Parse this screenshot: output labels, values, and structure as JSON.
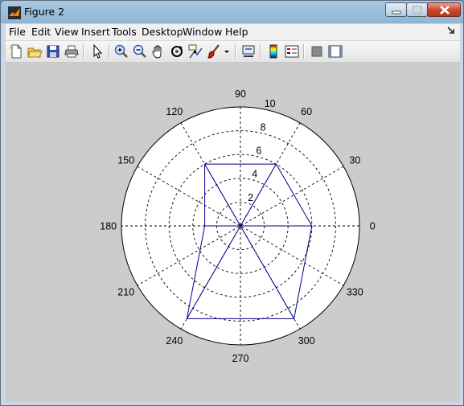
{
  "window": {
    "title": "Figure 2",
    "icon": "matlab-logo-icon"
  },
  "menubar": {
    "items": [
      "File",
      "Edit",
      "View",
      "Insert",
      "Tools",
      "Desktop",
      "Window",
      "Help"
    ],
    "dock_icon": "dock-arrow-icon"
  },
  "toolbar": {
    "buttons": [
      "new-figure-icon",
      "open-file-icon",
      "save-icon",
      "print-icon",
      "edit-plot-arrow-icon",
      "zoom-in-icon",
      "zoom-out-icon",
      "pan-hand-icon",
      "rotate-3d-icon",
      "data-cursor-icon",
      "brush-icon",
      "brush-dropdown-icon",
      "link-plot-icon",
      "insert-colorbar-icon",
      "insert-legend-icon",
      "hide-plot-tools-icon",
      "show-plot-tools-icon"
    ]
  },
  "colors": {
    "series": "#00008b",
    "figure_background": "#cccccc"
  },
  "chart_data": {
    "type": "polar",
    "r_ticks": [
      "2",
      "4",
      "6",
      "8",
      "10"
    ],
    "r_values": [
      2,
      4,
      6,
      8,
      10
    ],
    "rlim": [
      0,
      10
    ],
    "angle_ticks": [
      "0",
      "30",
      "60",
      "90",
      "120",
      "150",
      "180",
      "210",
      "240",
      "270",
      "300",
      "330"
    ],
    "angles_deg": [
      0,
      30,
      60,
      90,
      120,
      150,
      180,
      210,
      240,
      270,
      300,
      330
    ],
    "grid": true,
    "series": [
      {
        "theta_deg": [
          0,
          60,
          120,
          180,
          240,
          300,
          0
        ],
        "r": [
          6,
          6,
          6,
          3,
          9,
          9,
          6
        ]
      }
    ]
  }
}
